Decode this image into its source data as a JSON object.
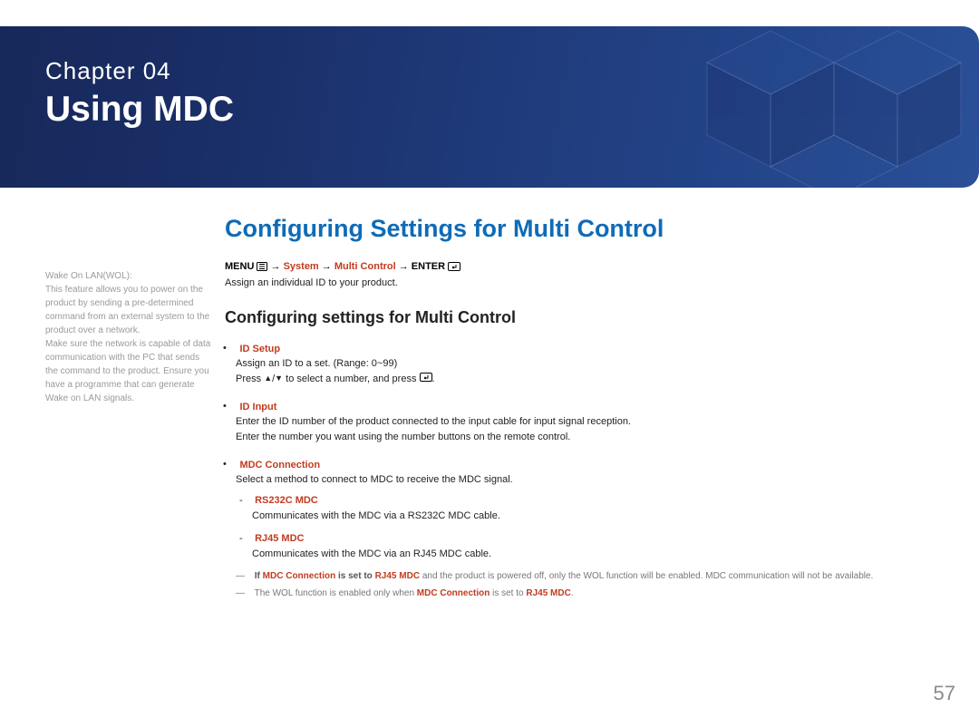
{
  "banner": {
    "chapter_label": "Chapter  04",
    "chapter_title": "Using MDC"
  },
  "sidebar": {
    "wol_head": "Wake On LAN(WOL):",
    "wol_body1": "This feature allows you to power on the product by sending a pre-determined command from an external system to the product over a network.",
    "wol_body2": "Make sure the network is capable of data communication with the PC that sends the command to the product. Ensure you have a programme that can generate Wake on LAN signals."
  },
  "main": {
    "section_title": "Configuring Settings for Multi Control",
    "navpath": {
      "menu": "MENU",
      "arrow": " → ",
      "system": "System",
      "multi": "Multi Control",
      "enter": "ENTER"
    },
    "assign_line": "Assign an individual ID to your product.",
    "subhead": "Configuring settings for Multi Control",
    "items": [
      {
        "title": "ID Setup",
        "lines": [
          "Assign an ID to a set. (Range: 0~99)"
        ],
        "press_prefix": "Press ",
        "press_sep": "/",
        "press_mid": " to select a number, and press ",
        "press_suffix": "."
      },
      {
        "title": "ID Input",
        "lines": [
          "Enter the ID number of the product connected to the input cable for input signal reception.",
          "Enter the number you want using the number buttons on the remote control."
        ]
      },
      {
        "title": "MDC Connection",
        "lines": [
          "Select a method to connect to MDC to receive the MDC signal."
        ],
        "sub": [
          {
            "title": "RS232C MDC",
            "body": "Communicates with the MDC via a RS232C MDC cable."
          },
          {
            "title": "RJ45 MDC",
            "body": "Communicates with the MDC via an RJ45 MDC cable."
          }
        ],
        "notes": [
          {
            "pre": "If ",
            "hl1": "MDC Connection",
            "mid1": " is set to ",
            "hl2": "RJ45 MDC",
            "post": " and the product is powered off, only the WOL function will be enabled. MDC communication will not be available."
          },
          {
            "pre": "The WOL function is enabled only when ",
            "hl1": "MDC Connection",
            "mid1": " is set to ",
            "hl2": "RJ45 MDC",
            "post": "."
          }
        ]
      }
    ]
  },
  "page_number": "57"
}
